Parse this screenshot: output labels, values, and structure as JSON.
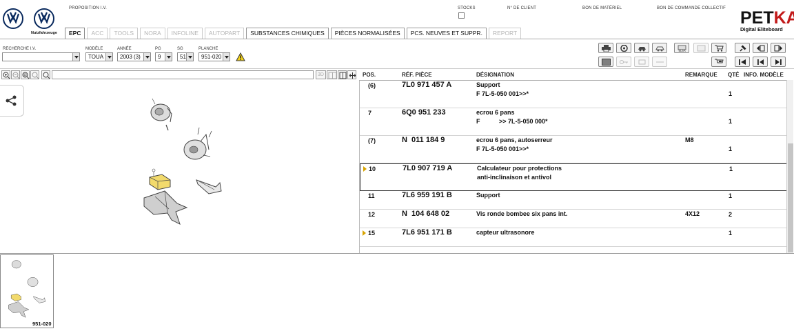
{
  "header": {
    "brand_sub": "Nutzfahrzeuge",
    "labels": {
      "proposition": "PROPOSITION I.V.",
      "stocks": "STOCKS",
      "client": "N° DE CLIENT",
      "bon_materiel": "BON DE MATÉRIEL",
      "bon_commande": "BON DE COMMANDE COLLECTIF"
    },
    "petka": {
      "title_a": "PET",
      "title_b": "KA",
      "subtitle": "Digital Eliteboard"
    }
  },
  "tabs": [
    {
      "label": "EPC",
      "state": "active"
    },
    {
      "label": "ACC",
      "state": "disabled"
    },
    {
      "label": "TOOLS",
      "state": "disabled"
    },
    {
      "label": "NORA",
      "state": "disabled"
    },
    {
      "label": "INFOLINE",
      "state": "disabled"
    },
    {
      "label": "AUTOPART",
      "state": "disabled"
    },
    {
      "label": "SUBSTANCES CHIMIQUES",
      "state": "enabled"
    },
    {
      "label": "PIÈCES NORMALISÉES",
      "state": "enabled"
    },
    {
      "label": "PCS. NEUVES ET SUPPR.",
      "state": "enabled"
    },
    {
      "label": "REPORT",
      "state": "disabled"
    }
  ],
  "filters": {
    "recherche_label": "RECHERCHE I.V.",
    "recherche_value": "",
    "modele_label": "MODÈLE",
    "modele_value": "TOUA",
    "annee_label": "ANNÉE",
    "annee_value": "2003 (3)",
    "pg_label": "PG",
    "pg_value": "9",
    "sg_label": "SG",
    "sg_value": "51",
    "planche_label": "PLANCHE",
    "planche_value": "951-020"
  },
  "table": {
    "headers": {
      "pos": "POS.",
      "ref": "RÉF. PIÈCE",
      "designation": "DÉSIGNATION",
      "remarque": "REMARQUE",
      "qte": "QTÉ",
      "info": "INFO. MODÈLE"
    },
    "rows": [
      {
        "pos": "(6)",
        "ref": "7L0 971 457 A",
        "des1": "Support",
        "des2": "F 7L-5-050 001>>*",
        "remarque": "",
        "qte": "1",
        "marker": false,
        "selected": false
      },
      {
        "pos": "7",
        "ref": "6Q0 951 233",
        "des1": "ecrou 6 pans",
        "des2": "F           >> 7L-5-050 000*",
        "remarque": "",
        "qte": "1",
        "marker": false,
        "selected": false
      },
      {
        "pos": "(7)",
        "ref": "N  011 184 9",
        "des1": "ecrou 6 pans, autoserreur",
        "des2": "F 7L-5-050 001>>*",
        "remarque": "M8",
        "qte": "1",
        "marker": false,
        "selected": false
      },
      {
        "pos": "10",
        "ref": "7L0 907 719 A",
        "des1": "Calculateur pour protections",
        "des2": "anti-inclinaison et antivol",
        "remarque": "",
        "qte": "1",
        "marker": true,
        "selected": true
      },
      {
        "pos": "11",
        "ref": "7L6 959 191 B",
        "des1": "Support",
        "des2": "",
        "remarque": "",
        "qte": "1",
        "marker": false,
        "selected": false
      },
      {
        "pos": "12",
        "ref": "N  104 648 02",
        "des1": "Vis ronde bombee six pans int.",
        "des2": "",
        "remarque": "4X12",
        "qte": "2",
        "marker": false,
        "selected": false
      },
      {
        "pos": "15",
        "ref": "7L6 951 171 B",
        "des1": "capteur ultrasonore",
        "des2": "",
        "remarque": "",
        "qte": "1",
        "marker": true,
        "selected": false
      }
    ]
  },
  "viewer": {
    "mode_3d": "3D"
  },
  "thumbnail": {
    "caption": "951-020"
  },
  "icons": {
    "toolbar": [
      "print-icon",
      "wheel-icon",
      "car-tools-icon",
      "car-icon",
      "elsa-icon",
      "export-icon",
      "cart-icon",
      "pin-icon",
      "prev-page-icon",
      "next-page-icon",
      "list-icon",
      "key-icon",
      "engine-icon",
      "arrow-icon",
      "cart-list-icon",
      "first-icon",
      "prev-icon",
      "next-icon"
    ]
  },
  "colors": {
    "marker": "#d8a300",
    "petka_accent": "#c21a1a",
    "vw_blue": "#0a2a5e"
  }
}
